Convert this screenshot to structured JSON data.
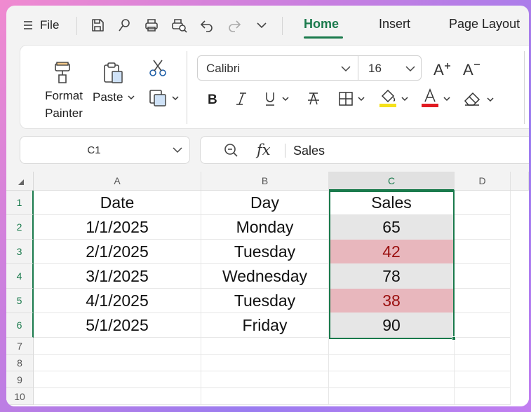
{
  "menu": {
    "file_label": "File",
    "tabs": [
      {
        "label": "Home",
        "active": true
      },
      {
        "label": "Insert",
        "active": false
      },
      {
        "label": "Page Layout",
        "active": false
      }
    ]
  },
  "ribbon": {
    "format_painter_line1": "Format",
    "format_painter_line2": "Painter",
    "paste_label": "Paste",
    "font_name": "Calibri",
    "font_size": "16",
    "highlight_color": "#f5e11a",
    "font_color": "#e11b22"
  },
  "namebox": {
    "value": "C1"
  },
  "formula": {
    "fx": "fx",
    "value": "Sales"
  },
  "accent_color": "#1a7a4c",
  "grid": {
    "columns": [
      "A",
      "B",
      "C",
      "D"
    ],
    "rows": [
      "1",
      "2",
      "3",
      "4",
      "5",
      "6",
      "7",
      "8",
      "9",
      "10"
    ],
    "cells": [
      [
        "Date",
        "Day",
        "Sales"
      ],
      [
        "1/1/2025",
        "Monday",
        "65"
      ],
      [
        "2/1/2025",
        "Tuesday",
        "42"
      ],
      [
        "3/1/2025",
        "Wednesday",
        "78"
      ],
      [
        "4/1/2025",
        "Tuesday",
        "38"
      ],
      [
        "5/1/2025",
        "Friday",
        "90"
      ]
    ],
    "highlight_fill": "#e8b7bd",
    "highlight_text": "#9a0e0e"
  }
}
